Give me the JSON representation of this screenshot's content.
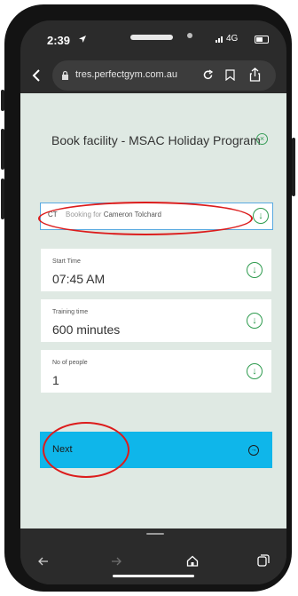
{
  "status": {
    "time": "2:39",
    "network": "4G"
  },
  "browser": {
    "url": "tres.perfectgym.com.au"
  },
  "page": {
    "title": "Book facility - MSAC Holiday Program",
    "booking": {
      "initials": "CT",
      "prefix": "Booking for",
      "name": "Cameron Tolchard"
    },
    "fields": [
      {
        "label": "Start Time",
        "value": "07:45 AM"
      },
      {
        "label": "Training time",
        "value": "600 minutes"
      },
      {
        "label": "No of people",
        "value": "1"
      }
    ],
    "next_label": "Next"
  },
  "colors": {
    "accent_green": "#2e9b4e",
    "next_blue": "#0fb6ea",
    "annotation_red": "#dc1c1c",
    "page_bg": "#dfe9e3"
  },
  "icons": [
    "location-arrow-icon",
    "signal-icon",
    "battery-icon",
    "back-icon",
    "lock-icon",
    "reload-icon",
    "bookmark-icon",
    "share-icon",
    "close-circle-icon",
    "download-circle-icon",
    "arrow-circle-right-icon",
    "nav-back-icon",
    "nav-forward-icon",
    "home-icon",
    "tabs-icon"
  ]
}
